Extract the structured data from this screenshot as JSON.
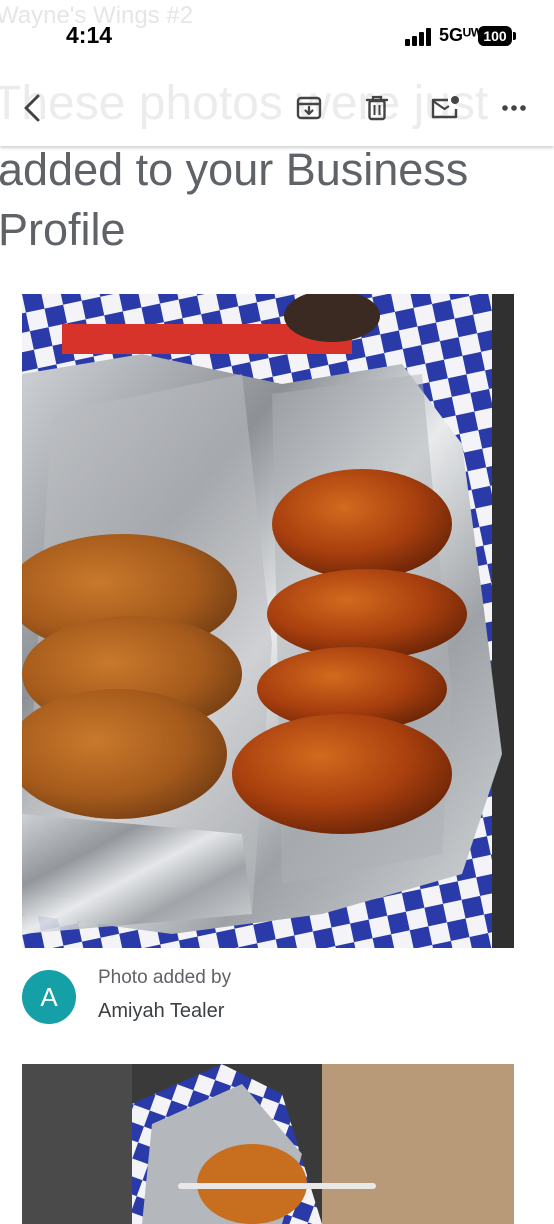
{
  "status_bar": {
    "ghost_subject": "Wayne's Wings #2",
    "time": "4:14",
    "network": "5Gᵁᵂ",
    "battery": "100"
  },
  "toolbar": {
    "ghost_title": "These photos were just",
    "icons": [
      "back-arrow-icon",
      "archive-icon",
      "trash-icon",
      "mark-unread-icon",
      "more-icon"
    ]
  },
  "email": {
    "subject_line_1": "added to your Business",
    "subject_line_2": "Profile",
    "photo_card": {
      "avatar_letter": "A",
      "avatar_color": "#14a0a6",
      "caption_label": "Photo added by",
      "author": "Amiyah Tealer"
    }
  }
}
